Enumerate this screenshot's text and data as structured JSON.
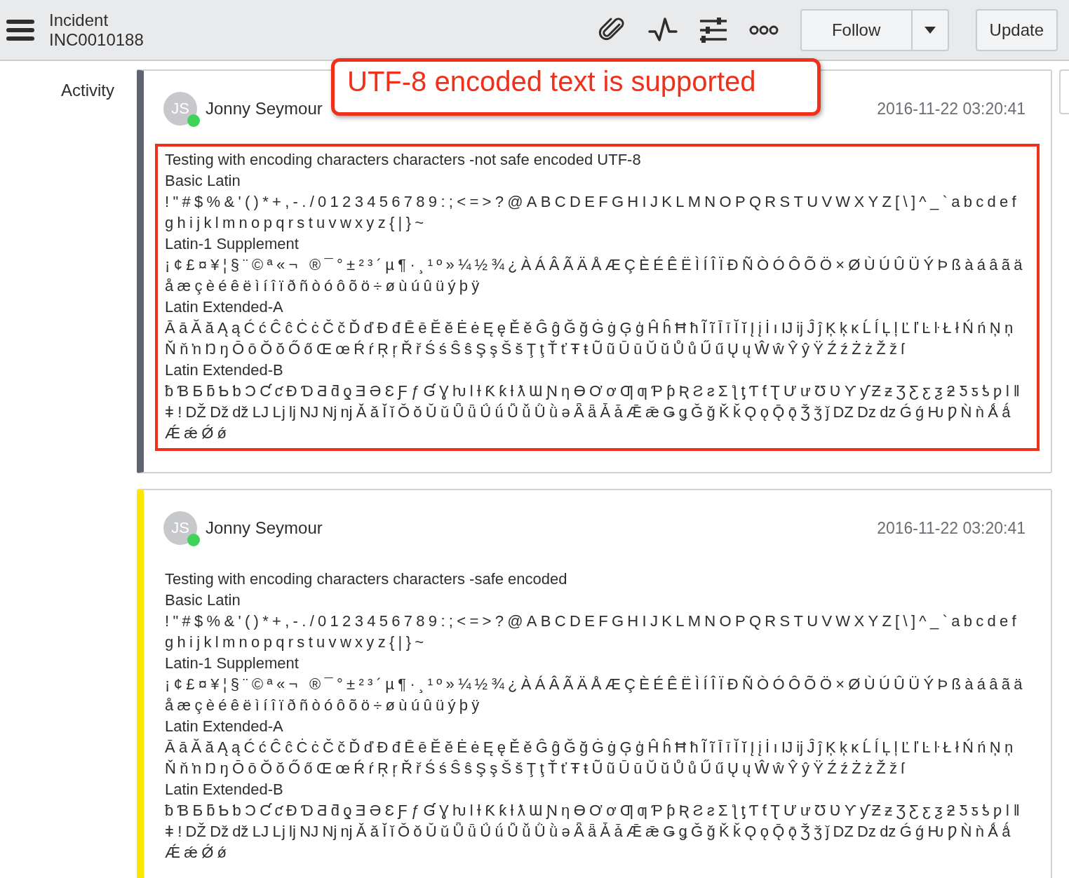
{
  "header": {
    "title": "Incident",
    "number": "INC0010188",
    "follow_button": "Follow",
    "update_button": "Update"
  },
  "activity_label": "Activity",
  "callout": "UTF-8 encoded text is supported",
  "entries": [
    {
      "initials": "JS",
      "author": "Jonny Seymour",
      "online": true,
      "timestamp": "2016-11-22 03:20:41",
      "color": "#5f6570",
      "highlighted": true,
      "lines": [
        {
          "kind": "text",
          "text": "Testing with encoding characters characters -not safe encoded UTF-8"
        },
        {
          "kind": "text",
          "text": "Basic Latin"
        },
        {
          "kind": "chars",
          "text": "!\"#$%&'()*+,-./0123456789:;<=>?@ABCDEFGHIJKLMNOPQRSTUVWXYZ[\\]^_`abcdefghijklmnopqrstuvwxyz{|}~"
        },
        {
          "kind": "text",
          "text": "Latin-1 Supplement"
        },
        {
          "kind": "chars",
          "text": "¡¢£¤¥¦§¨©ª«¬ ®¯°±²³´µ¶·¸¹º»¼½¾¿ÀÁÂÃÄÅÆÇÈÉÊËÌÍÎÏÐÑÒÓÔÕÖ×ØÙÚÛÜÝÞßàáâãäåæçèéêëìíîïðñòóôõö÷øùúûüýþÿ"
        },
        {
          "kind": "text",
          "text": "Latin Extended-A"
        },
        {
          "kind": "chars",
          "text": "ĀāĂăĄąĆćĈĉĊċČčĎďĐđĒēĔĕĖėĘęĚěĜĝĞğĠġĢģĤĥĦħĨĩĪīĬĭĮįİıĲĳĴĵĶķĸĹĺĻļĽľĿŀŁłŃńŅņŇňŉŊŋŌōŎŏŐőŒœŔŕŖŗŘřŚśŜŝŞşŠšŢţŤťŦŧŨũŪūŬŭŮůŰűŲųŴŵŶŷŸŹźŻżŽžſ"
        },
        {
          "kind": "text",
          "text": "Latin Extended-B"
        },
        {
          "kind": "chars",
          "text": "ƀƁƂƃƄƅƆƇƈƉƊƋƌƍƎƏƐƑƒƓƔƕƖƗƘƙƚƛƜƝƞƟƠơƢƣƤƥƦƧƨƩƪƫƬƭƮƯưƱƲƳƴƵƶƷƸƹƺƻƼƽƾƿǀǁǂǃǄǅǆǇǈǉǊǋǌǍǎǏǐǑǒǓǔǕǖǗǘǙǚǛǜǝǞǟǠǡǢǣǤǥǦǧǨǩǪǫǬǭǮǯǰǱǲǳǴǵǶǷǸǹǺǻǼǽǾǿ"
        }
      ]
    },
    {
      "initials": "JS",
      "author": "Jonny Seymour",
      "online": true,
      "timestamp": "2016-11-22 03:20:41",
      "color": "#ffe600",
      "highlighted": false,
      "lines": [
        {
          "kind": "text",
          "text": "Testing with encoding characters characters -safe encoded"
        },
        {
          "kind": "text",
          "text": "Basic Latin"
        },
        {
          "kind": "chars",
          "text": "!\"#$%&'()*+,-./0123456789:;<=>?@ABCDEFGHIJKLMNOPQRSTUVWXYZ[\\]^_`abcdefghijklmnopqrstuvwxyz{|}~"
        },
        {
          "kind": "text",
          "text": "Latin-1 Supplement"
        },
        {
          "kind": "chars",
          "text": "¡¢£¤¥¦§¨©ª«¬ ®¯°±²³´µ¶·¸¹º»¼½¾¿ÀÁÂÃÄÅÆÇÈÉÊËÌÍÎÏÐÑÒÓÔÕÖ×ØÙÚÛÜÝÞßàáâãäåæçèéêëìíîïðñòóôõö÷øùúûüýþÿ"
        },
        {
          "kind": "text",
          "text": "Latin Extended-A"
        },
        {
          "kind": "chars",
          "text": "ĀāĂăĄąĆćĈĉĊċČčĎďĐđĒēĔĕĖėĘęĚěĜĝĞğĠġĢģĤĥĦħĨĩĪīĬĭĮįİıĲĳĴĵĶķĸĹĺĻļĽľĿŀŁłŃńŅņŇňŉŊŋŌōŎŏŐőŒœŔŕŖŗŘřŚśŜŝŞşŠšŢţŤťŦŧŨũŪūŬŭŮůŰűŲųŴŵŶŷŸŹźŻżŽžſ"
        },
        {
          "kind": "text",
          "text": "Latin Extended-B"
        },
        {
          "kind": "chars",
          "text": "ƀƁƂƃƄƅƆƇƈƉƊƋƌƍƎƏƐƑƒƓƔƕƖƗƘƙƚƛƜƝƞƟƠơƢƣƤƥƦƧƨƩƪƫƬƭƮƯưƱƲƳƴƵƶƷƸƹƺƻƼƽƾƿǀǁǂǃǄǅǆǇǈǉǊǋǌǍǎǏǐǑǒǓǔǕǖǗǘǙǚǛǜǝǞǟǠǡǢǣǤǥǦǧǨǩǪǫǬǭǮǯǰǱǲǳǴǵǶǷǸǹǺǻǼǽǾǿ"
        }
      ]
    }
  ]
}
